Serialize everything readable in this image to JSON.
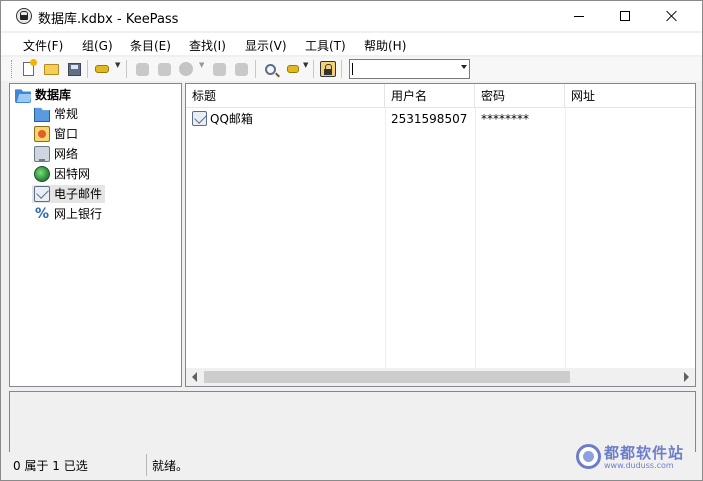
{
  "window": {
    "title": "数据库.kdbx - KeePass",
    "icon": "keepass-lock-icon"
  },
  "menu": {
    "items": [
      {
        "label": "文件(F)"
      },
      {
        "label": "组(G)"
      },
      {
        "label": "条目(E)"
      },
      {
        "label": "查找(I)"
      },
      {
        "label": "显示(V)"
      },
      {
        "label": "工具(T)"
      },
      {
        "label": "帮助(H)"
      }
    ]
  },
  "toolbar": {
    "buttons": [
      "new-database-icon",
      "open-folder-icon",
      "save-disk-icon",
      "add-entry-key-icon",
      "edit-entry-icon",
      "delete-entry-icon",
      "copy-username-icon",
      "copy-password-icon",
      "open-url-icon",
      "find-magnifier-icon",
      "entries-filter-icon",
      "lock-workspace-icon"
    ],
    "quick_find": {
      "value": ""
    }
  },
  "groups": {
    "root": {
      "label": "数据库",
      "icon": "folder-open-icon"
    },
    "children": [
      {
        "label": "常规",
        "icon": "folder-icon"
      },
      {
        "label": "窗口",
        "icon": "window-icon"
      },
      {
        "label": "网络",
        "icon": "network-icon"
      },
      {
        "label": "因特网",
        "icon": "globe-icon"
      },
      {
        "label": "电子邮件",
        "icon": "email-icon",
        "selected": true
      },
      {
        "label": "网上银行",
        "icon": "percent-icon"
      }
    ]
  },
  "entries": {
    "columns": [
      "标题",
      "用户名",
      "密码",
      "网址"
    ],
    "rows": [
      {
        "title": "QQ邮箱",
        "username": "2531598507",
        "password": "********",
        "url": "",
        "icon": "email-icon"
      }
    ]
  },
  "status": {
    "selection": "0 属于 1 已选",
    "message": "就绪。"
  },
  "watermark": {
    "text": "都都软件站",
    "url": "www.duduss.com"
  }
}
